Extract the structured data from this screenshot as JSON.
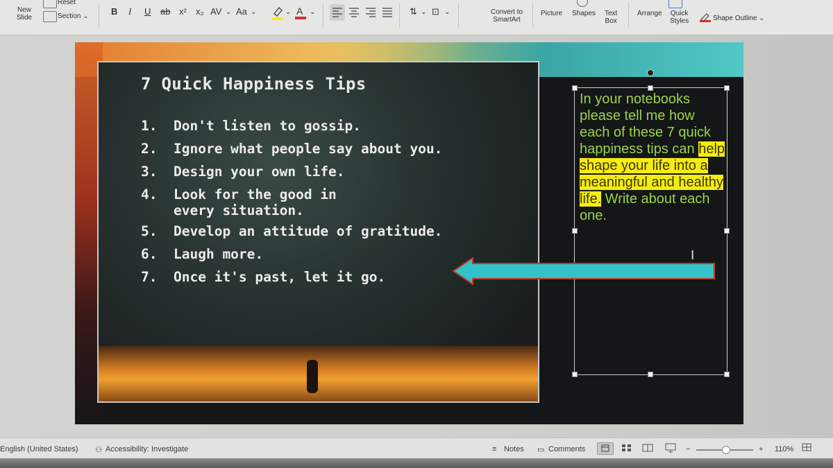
{
  "ribbon": {
    "new_slide": "New\nSlide",
    "reset": "Reset",
    "section": "Section",
    "font_bold": "B",
    "font_italic": "I",
    "font_underline": "U",
    "font_strike": "ab",
    "superscript": "x²",
    "subscript": "x₂",
    "char_spacing": "AV",
    "change_case": "Aa",
    "convert_smartart": "Convert to\nSmartArt",
    "picture": "Picture",
    "shapes": "Shapes",
    "text_box": "Text\nBox",
    "arrange": "Arrange",
    "quick_styles": "Quick\nStyles",
    "shape_outline": "Shape Outline",
    "highlight_color": "#f5ec12",
    "font_color": "#d0312d"
  },
  "slide": {
    "title": "7 Quick Happiness Tips",
    "tips": [
      {
        "num": "1.",
        "text": "Don't listen to gossip."
      },
      {
        "num": "2.",
        "text": "Ignore what people say about you."
      },
      {
        "num": "3.",
        "text": "Design your own life."
      },
      {
        "num": "4.",
        "text": "Look for the good in",
        "cont": "every situation."
      },
      {
        "num": "5.",
        "text": "Develop an attitude of gratitude."
      },
      {
        "num": "6.",
        "text": "Laugh more."
      },
      {
        "num": "7.",
        "text": "Once it's past, let it go."
      }
    ],
    "note_plain_1": "In your notebooks please tell me how each of these 7 quick happiness tips can ",
    "note_highlight": "help shape your life into a meaningful and healthy life.",
    "note_plain_2": " Write about each one.",
    "note_color": "#9bd44a",
    "arrow_color": "#33c2c9"
  },
  "status": {
    "language": "English (United States)",
    "accessibility": "Accessibility: Investigate",
    "notes": "Notes",
    "comments": "Comments",
    "zoom_out": "−",
    "zoom_in": "+",
    "zoom": "110%"
  }
}
